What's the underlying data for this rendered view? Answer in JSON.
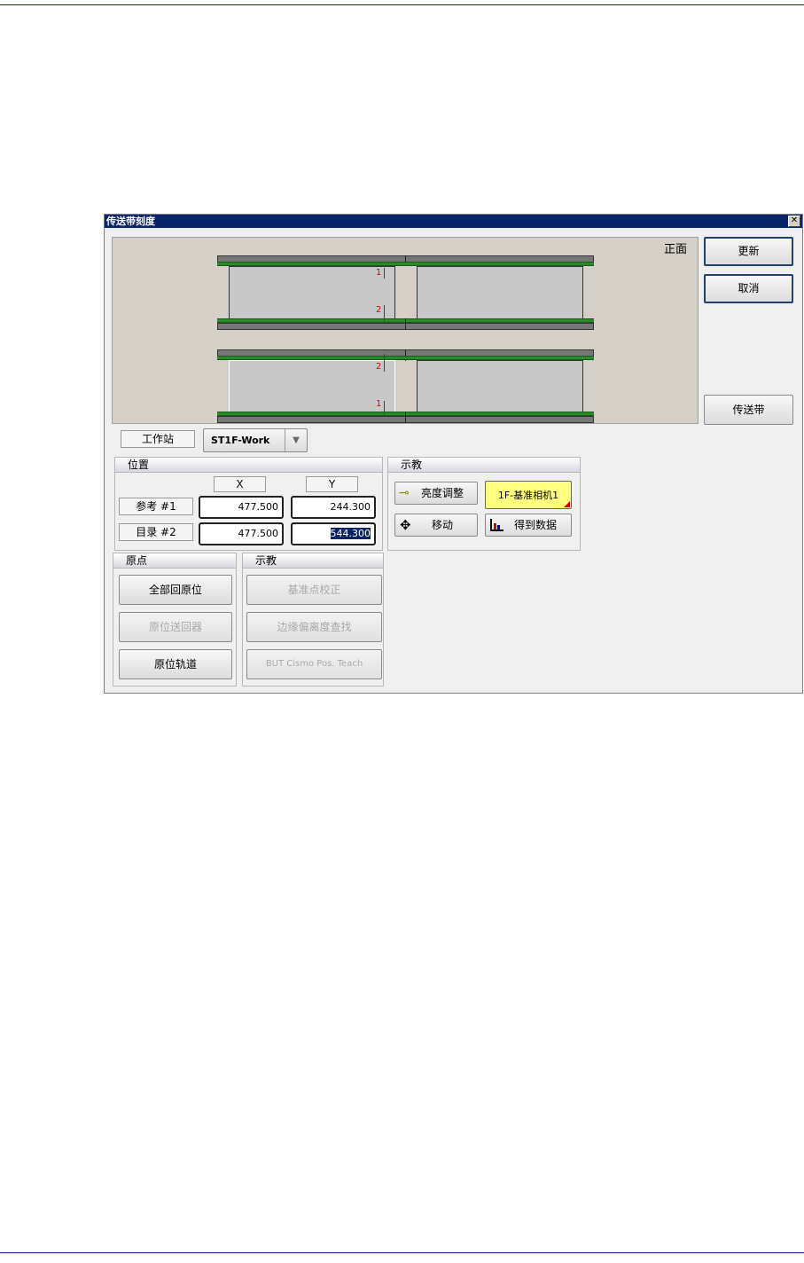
{
  "window": {
    "title": "传送带刻度",
    "close_glyph": "✕"
  },
  "canvas": {
    "view_label": "正面",
    "marks": {
      "one": "1",
      "two": "2"
    }
  },
  "side_buttons": {
    "update": "更新",
    "cancel": "取消",
    "conveyor": "传送带"
  },
  "station": {
    "label": "工作站",
    "value": "ST1F-Work"
  },
  "position": {
    "title": "位置",
    "col_x": "X",
    "col_y": "Y",
    "rows": [
      {
        "label": "参考 #1",
        "x": "477.500",
        "y": "244.300"
      },
      {
        "label": "目录 #2",
        "x": "477.500",
        "y": "544.300"
      }
    ]
  },
  "teach_top": {
    "title": "示教",
    "brightness": "亮度调整",
    "camera": "1F-基准相机1",
    "move": "移动",
    "get_data": "得到数据"
  },
  "origin": {
    "title": "原点",
    "all_home": "全部回原位",
    "home_return": "原位送回器",
    "home_track": "原位轨道"
  },
  "teach_bottom": {
    "title": "示教",
    "fiducial": "基准点校正",
    "edge": "边缘偏离度查找",
    "but": "BUT Cismo Pos. Teach"
  },
  "icons": {
    "brightness": "plug-icon",
    "move": "move-arrows-icon",
    "data": "chart-axes-icon",
    "dropdown": "dropdown-arrow-icon"
  },
  "colors": {
    "title_bar": "#0a246a",
    "rail": "#2a8a2a",
    "highlight": "#ffff80",
    "marker": "#e00000"
  }
}
